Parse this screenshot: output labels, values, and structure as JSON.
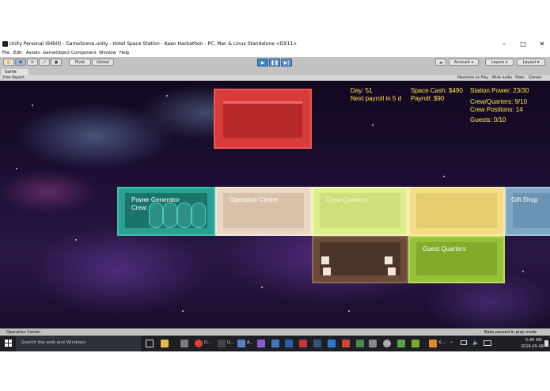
{
  "window": {
    "title": "Unity Personal (64bit) - GameScene.unity - Hotel Space Station - Kean Hackathon - PC, Mac & Linux Standalone <DX11>",
    "minimize": "–",
    "maximize": "□",
    "close": "✕"
  },
  "menu": [
    "File",
    "Edit",
    "Assets",
    "GameObject",
    "Component",
    "Window",
    "Help"
  ],
  "toolbar": {
    "pivot": "Pivot",
    "global": "Global",
    "account": "Account",
    "layers": "Layers",
    "layout": "Layout"
  },
  "game_view": {
    "tab": "Game",
    "aspect": "Free Aspect",
    "options": [
      "Maximize on Play",
      "Mute audio",
      "Stats",
      "Gizmos"
    ]
  },
  "hud": {
    "day": "Day: 51",
    "payroll_due": "Next payroll in 5 d",
    "space_cash": "Space Cash: $490",
    "payroll": "Payroll: $90",
    "station_power": "Station Power: 23/30",
    "crew_quarters": "Crew/Quarters: 9/10",
    "crew_positions": "Crew Positions: 14",
    "guests": "Guests: 0/10"
  },
  "rooms": {
    "power_generator": {
      "label": "Power Generator",
      "crew": "Crew: 0",
      "color": "#2aa092"
    },
    "operation_center": {
      "label": "Operation Center",
      "color": "#e9d6c3"
    },
    "crew_quarters": {
      "label": "Crew Quarters",
      "color": "#dfee8f"
    },
    "yellow_room": {
      "label": "",
      "color": "#f4dd84"
    },
    "gift_shop": {
      "label": "Gift Shop",
      "color": "#7ea7c7"
    },
    "guest_quarters": {
      "label": "Guest Quarters",
      "color": "#96c23a"
    },
    "brown_room": {
      "label": "",
      "color": "#6a4b3a"
    },
    "red_room": {
      "label": "",
      "color": "#d93b3b"
    }
  },
  "status": {
    "left": "Operation Center",
    "right": "Bake paused in play mode"
  },
  "taskbar": {
    "search": "Search the web and Windows",
    "time": "5:40 AM",
    "date": "2016-05-08",
    "apps": [
      "U...",
      "A...",
      "D...",
      "X..."
    ]
  }
}
